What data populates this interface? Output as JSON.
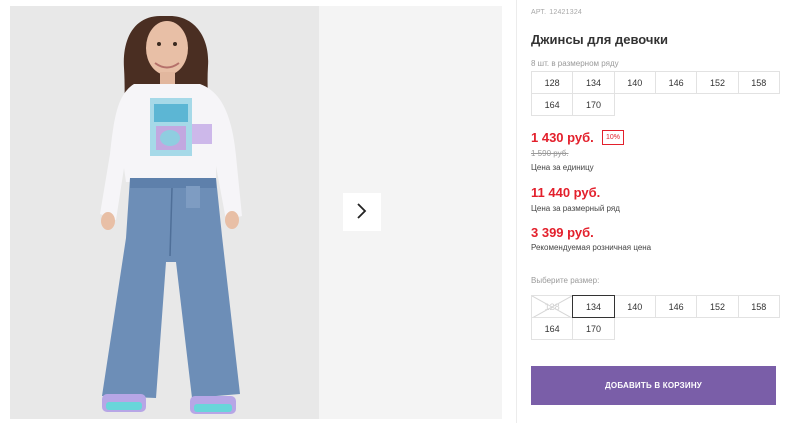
{
  "product": {
    "art_label": "АРТ.",
    "art_number": "12421324",
    "title": "Джинсы для девочки",
    "pack_note": "8 шт. в размерном ряду",
    "pack_sizes": [
      "128",
      "134",
      "140",
      "146",
      "152",
      "158",
      "164",
      "170"
    ]
  },
  "pricing": {
    "unit_price": "1 430 руб.",
    "discount": "10%",
    "old_price": "1 590 руб.",
    "unit_caption": "Цена за единицу",
    "set_price": "11 440 руб.",
    "set_caption": "Цена за размерный ряд",
    "rrp": "3 399 руб.",
    "rrp_caption": "Рекомендуемая розничная цена"
  },
  "size_picker": {
    "label": "Выберите размер:",
    "selected": "134",
    "sizes": [
      {
        "label": "128",
        "state": "unavailable"
      },
      {
        "label": "134",
        "state": "selected"
      },
      {
        "label": "140",
        "state": "available"
      },
      {
        "label": "146",
        "state": "available"
      },
      {
        "label": "152",
        "state": "available"
      },
      {
        "label": "158",
        "state": "available"
      },
      {
        "label": "164",
        "state": "available"
      },
      {
        "label": "170",
        "state": "available"
      }
    ]
  },
  "cart": {
    "button_label": "ДОБАВИТЬ В КОРЗИНУ"
  },
  "gallery": {
    "next_icon": "chevron-right-icon"
  },
  "colors": {
    "accent_price": "#e3202c",
    "cart_button": "#7a5ea8",
    "border": "#e2e2e2"
  }
}
